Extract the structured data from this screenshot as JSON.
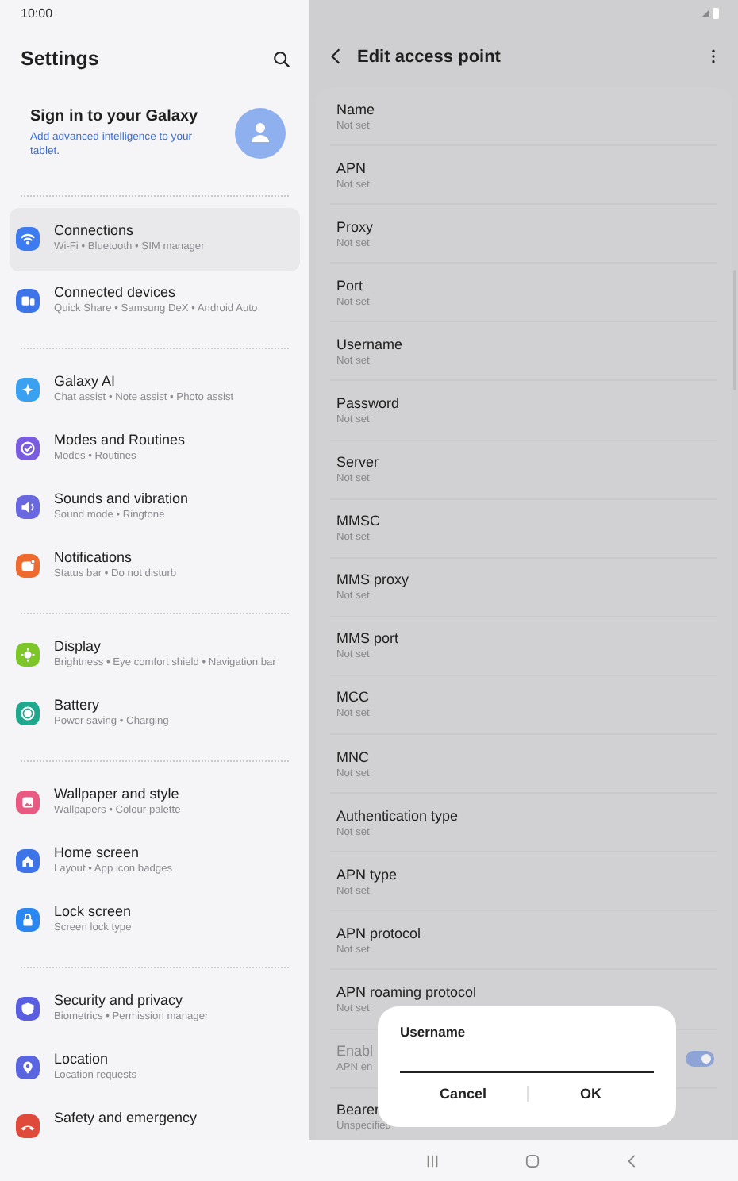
{
  "status_bar": {
    "time": "10:00"
  },
  "settings": {
    "title": "Settings",
    "account": {
      "title": "Sign in to your Galaxy",
      "subtitle": "Add advanced intelligence to your tablet."
    },
    "groups": [
      {
        "items": [
          {
            "kind": "wifi",
            "color": "#3d7cf0",
            "title": "Connections",
            "subtitle": "Wi-Fi  •  Bluetooth  •  SIM manager",
            "selected": true
          },
          {
            "kind": "devices",
            "color": "#3d74e8",
            "title": "Connected devices",
            "subtitle": "Quick Share  •  Samsung DeX  •  Android Auto",
            "selected": false
          }
        ]
      },
      {
        "items": [
          {
            "kind": "sparkle",
            "color": "#3aa0f0",
            "title": "Galaxy AI",
            "subtitle": "Chat assist  •  Note assist  •  Photo assist",
            "selected": false
          },
          {
            "kind": "check",
            "color": "#7a5ce0",
            "title": "Modes and Routines",
            "subtitle": "Modes  •  Routines",
            "selected": false
          },
          {
            "kind": "sound",
            "color": "#6a68e0",
            "title": "Sounds and vibration",
            "subtitle": "Sound mode  •  Ringtone",
            "selected": false
          },
          {
            "kind": "bell",
            "color": "#ee6a2e",
            "title": "Notifications",
            "subtitle": "Status bar  •  Do not disturb",
            "selected": false
          }
        ]
      },
      {
        "items": [
          {
            "kind": "sun",
            "color": "#7cc62a",
            "title": "Display",
            "subtitle": "Brightness  •  Eye comfort shield  •  Navigation bar",
            "selected": false
          },
          {
            "kind": "battery",
            "color": "#20a88e",
            "title": "Battery",
            "subtitle": "Power saving  •  Charging",
            "selected": false
          }
        ]
      },
      {
        "items": [
          {
            "kind": "image",
            "color": "#e85a82",
            "title": "Wallpaper and style",
            "subtitle": "Wallpapers  •  Colour palette",
            "selected": false
          },
          {
            "kind": "home",
            "color": "#3d74e8",
            "title": "Home screen",
            "subtitle": "Layout  •  App icon badges",
            "selected": false
          },
          {
            "kind": "lock",
            "color": "#2a86f0",
            "title": "Lock screen",
            "subtitle": "Screen lock type",
            "selected": false
          }
        ]
      },
      {
        "items": [
          {
            "kind": "shield",
            "color": "#5a5ee0",
            "title": "Security and privacy",
            "subtitle": "Biometrics  •  Permission manager",
            "selected": false
          },
          {
            "kind": "pin",
            "color": "#5a66e0",
            "title": "Location",
            "subtitle": "Location requests",
            "selected": false
          },
          {
            "kind": "phone",
            "color": "#e04a3a",
            "title": "Safety and emergency",
            "selected": false
          }
        ]
      }
    ]
  },
  "detail": {
    "title": "Edit access point",
    "rows": [
      {
        "kind": "text",
        "title": "Name",
        "value": "Not set"
      },
      {
        "kind": "text",
        "title": "APN",
        "value": "Not set"
      },
      {
        "kind": "text",
        "title": "Proxy",
        "value": "Not set"
      },
      {
        "kind": "text",
        "title": "Port",
        "value": "Not set"
      },
      {
        "kind": "text",
        "title": "Username",
        "value": "Not set"
      },
      {
        "kind": "text",
        "title": "Password",
        "value": "Not set"
      },
      {
        "kind": "text",
        "title": "Server",
        "value": "Not set"
      },
      {
        "kind": "text",
        "title": "MMSC",
        "value": "Not set"
      },
      {
        "kind": "text",
        "title": "MMS proxy",
        "value": "Not set"
      },
      {
        "kind": "text",
        "title": "MMS port",
        "value": "Not set"
      },
      {
        "kind": "text",
        "title": "MCC",
        "value": "Not set"
      },
      {
        "kind": "text",
        "title": "MNC",
        "value": "Not set"
      },
      {
        "kind": "text",
        "title": "Authentication type",
        "value": "Not set"
      },
      {
        "kind": "text",
        "title": "APN type",
        "value": "Not set"
      },
      {
        "kind": "text",
        "title": "APN protocol",
        "value": "Not set"
      },
      {
        "kind": "text",
        "title": "APN roaming protocol",
        "value": "Not set"
      },
      {
        "kind": "toggle",
        "title": "Enabl",
        "value": "APN en",
        "disabled": true,
        "on": true
      },
      {
        "kind": "text",
        "title": "Bearer",
        "value": "Unspecified"
      }
    ]
  },
  "dialog": {
    "title": "Username",
    "buttons": [
      "Cancel",
      "OK"
    ]
  }
}
